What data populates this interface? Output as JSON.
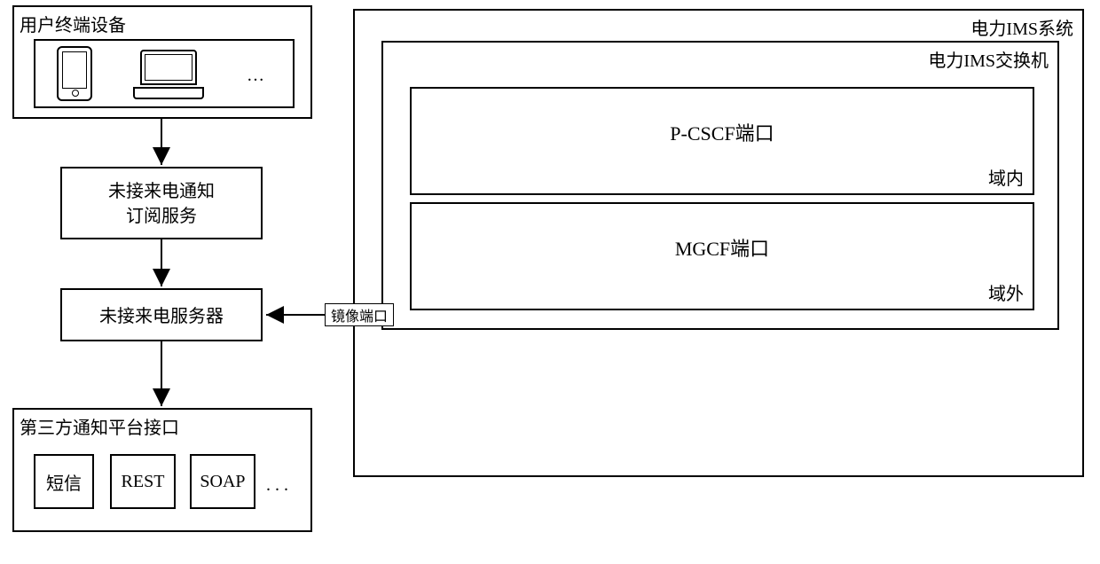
{
  "user_terminal": {
    "title": "用户终端设备",
    "ellipsis": "…"
  },
  "subscribe_service": {
    "line1": "未接来电通知",
    "line2": "订阅服务"
  },
  "missed_call_server": "未接来电服务器",
  "third_party": {
    "title": "第三方通知平台接口",
    "items": [
      "短信",
      "REST",
      "SOAP"
    ],
    "ellipsis": ". . ."
  },
  "ims_system": {
    "title": "电力IMS系统",
    "switch_title": "电力IMS交换机",
    "mirror_port": "镜像端口",
    "pcscf": {
      "title": "P-CSCF端口",
      "domain": "域内"
    },
    "mgcf": {
      "title": "MGCF端口",
      "domain": "域外"
    }
  }
}
